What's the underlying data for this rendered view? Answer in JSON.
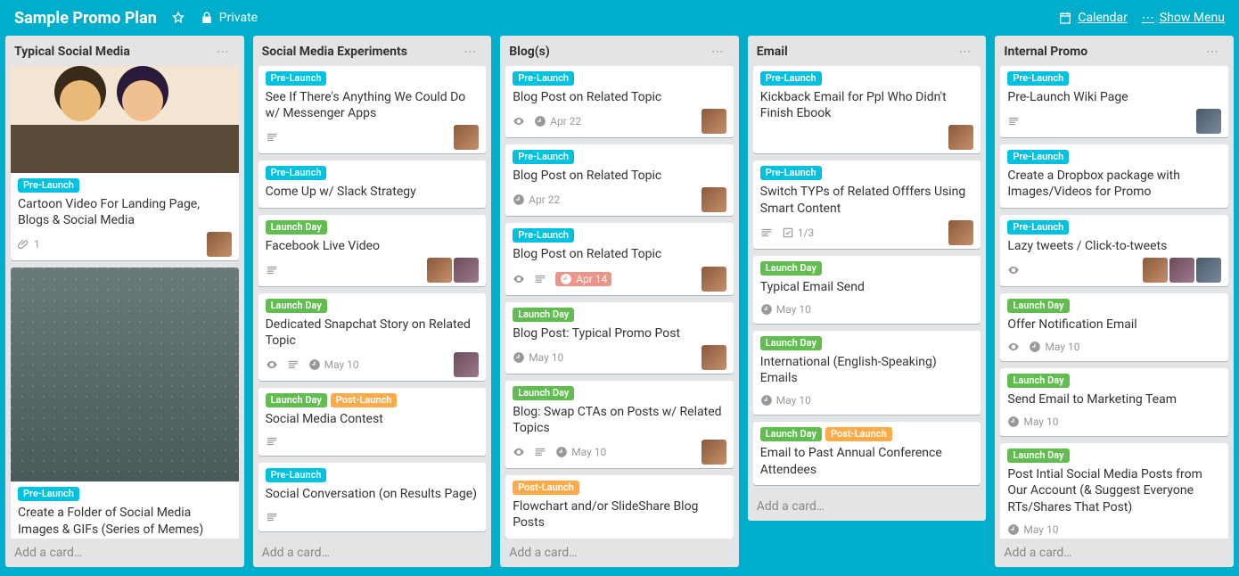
{
  "header": {
    "title": "Sample Promo Plan",
    "privacy": "Private",
    "calendar": "Calendar",
    "showMenu": "Show Menu"
  },
  "addCard": "Add a card…",
  "labelNames": {
    "preLaunch": "Pre-Launch",
    "launchDay": "Launch Day",
    "postLaunch": "Post-Launch"
  },
  "lists": [
    {
      "name": "Typical Social Media",
      "cards": [
        {
          "cover": "illust",
          "labels": [
            "preLaunch"
          ],
          "title": "Cartoon Video For Landing Page, Blogs & Social Media",
          "attachments": 1,
          "members": [
            "a1"
          ]
        },
        {
          "cover": "rain",
          "coverTall": true,
          "labels": [
            "preLaunch"
          ],
          "title": "Create a Folder of Social Media Images & GIFs (Series of Memes)"
        }
      ]
    },
    {
      "name": "Social Media Experiments",
      "cards": [
        {
          "labels": [
            "preLaunch"
          ],
          "title": "See If There's Anything We Could Do w/ Messenger Apps",
          "desc": true,
          "members": [
            "a1"
          ]
        },
        {
          "labels": [
            "preLaunch"
          ],
          "title": "Come Up w/ Slack Strategy"
        },
        {
          "labels": [
            "launchDay"
          ],
          "title": "Facebook Live Video",
          "desc": true,
          "members": [
            "a1",
            "a2"
          ]
        },
        {
          "labels": [
            "launchDay"
          ],
          "title": "Dedicated Snapchat Story on Related Topic",
          "watch": true,
          "desc": true,
          "due": "May 10",
          "members": [
            "a2"
          ]
        },
        {
          "labels": [
            "launchDay",
            "postLaunch"
          ],
          "title": "Social Media Contest",
          "desc": true
        },
        {
          "labels": [
            "preLaunch"
          ],
          "title": "Social Conversation (on Results Page)",
          "desc": true
        }
      ]
    },
    {
      "name": "Blog(s)",
      "cards": [
        {
          "labels": [
            "preLaunch"
          ],
          "title": "Blog Post on Related Topic",
          "watch": true,
          "due": "Apr 22",
          "members": [
            "a1"
          ]
        },
        {
          "labels": [
            "preLaunch"
          ],
          "title": "Blog Post on Related Topic",
          "due": "Apr 22",
          "members": [
            "a1"
          ]
        },
        {
          "labels": [
            "preLaunch"
          ],
          "title": "Blog Post on Related Topic",
          "watch": true,
          "desc": true,
          "due": "Apr 14",
          "duePast": true,
          "members": [
            "a1"
          ]
        },
        {
          "labels": [
            "launchDay"
          ],
          "title": "Blog Post: Typical Promo Post",
          "due": "May 10",
          "members": [
            "a1"
          ]
        },
        {
          "labels": [
            "launchDay"
          ],
          "title": "Blog: Swap CTAs on Posts w/ Related Topics",
          "watch": true,
          "desc": true,
          "due": "May 10",
          "members": [
            "a1"
          ]
        },
        {
          "labels": [
            "postLaunch"
          ],
          "title": "Flowchart and/or SlideShare Blog Posts"
        }
      ]
    },
    {
      "name": "Email",
      "cards": [
        {
          "labels": [
            "preLaunch"
          ],
          "title": "Kickback Email for Ppl Who Didn't Finish Ebook",
          "members": [
            "a1"
          ]
        },
        {
          "labels": [
            "preLaunch"
          ],
          "title": "Switch TYPs of Related Offfers Using Smart Content",
          "desc": true,
          "checklist": "1/3",
          "members": [
            "a1"
          ]
        },
        {
          "labels": [
            "launchDay"
          ],
          "title": "Typical Email Send",
          "due": "May 10"
        },
        {
          "labels": [
            "launchDay"
          ],
          "title": "International (English-Speaking) Emails",
          "due": "May 10"
        },
        {
          "labels": [
            "launchDay",
            "postLaunch"
          ],
          "title": "Email to Past Annual Conference Attendees"
        }
      ]
    },
    {
      "name": "Internal Promo",
      "cards": [
        {
          "labels": [
            "preLaunch"
          ],
          "title": "Pre-Launch Wiki Page",
          "desc": true,
          "members": [
            "a3"
          ]
        },
        {
          "labels": [
            "preLaunch"
          ],
          "title": "Create a Dropbox package with Images/Videos for Promo"
        },
        {
          "labels": [
            "preLaunch"
          ],
          "title": "Lazy tweets / Click-to-tweets",
          "watch": true,
          "members": [
            "a1",
            "a2",
            "a3"
          ]
        },
        {
          "labels": [
            "launchDay"
          ],
          "title": "Offer Notification Email",
          "watch": true,
          "due": "May 10"
        },
        {
          "labels": [
            "launchDay"
          ],
          "title": "Send Email to Marketing Team",
          "due": "May 10"
        },
        {
          "labels": [
            "launchDay"
          ],
          "title": "Post Intial Social Media Posts from Our Account (& Suggest Everyone RTs/Shares That Post)",
          "due": "May 10"
        }
      ]
    }
  ]
}
